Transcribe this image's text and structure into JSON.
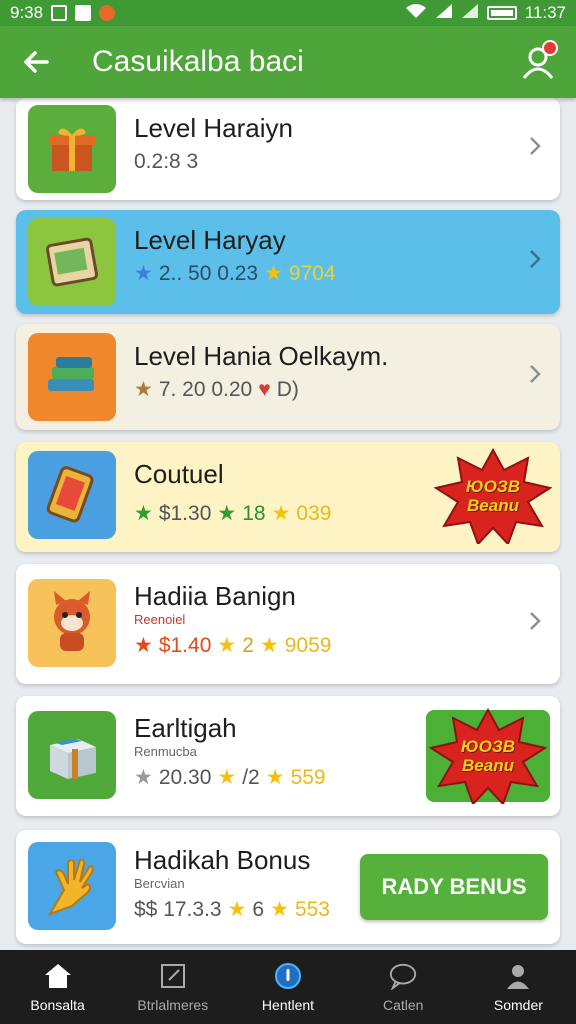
{
  "status_bar": {
    "time": "9:38",
    "clock": "11:37"
  },
  "app_bar": {
    "title": "Casuikalba baci"
  },
  "items": [
    {
      "name": "Level Haraiyn",
      "meta": [
        "0.2:8 3"
      ],
      "icon": "gift-box-icon"
    },
    {
      "name": "Level Haryay",
      "meta": [
        "2.. 50 0.23",
        "9704"
      ],
      "icon": "book-icon"
    },
    {
      "name": "Level Hania Oelkaym.",
      "meta": [
        "7. 20 0.20",
        "D)"
      ],
      "icon": "books-icon"
    },
    {
      "name": "Coutuel",
      "meta": [
        "$1.30",
        "18",
        "039"
      ],
      "icon": "phone-card-icon",
      "burst": [
        "ЮОЗВ",
        "Beanu"
      ]
    },
    {
      "name": "Hadiia Banign",
      "sub": "Reenoiel",
      "meta": [
        "$1.40",
        "2",
        "9059"
      ],
      "icon": "fox-mascot-icon"
    },
    {
      "name": "Earltigah",
      "sub": "Renmucba",
      "meta": [
        "20.30",
        "/2",
        "559"
      ],
      "icon": "crate-icon",
      "burst": [
        "ЮОЗВ",
        "Beanu"
      ]
    },
    {
      "name": "Hadikah Bonus",
      "sub": "Bercvian",
      "meta": [
        "$$ 17.3.3",
        "6",
        "553"
      ],
      "icon": "golden-hand-icon",
      "button": "RADY BENUS"
    }
  ],
  "nav": [
    {
      "label": "Bonsalta",
      "icon": "home-icon"
    },
    {
      "label": "Btrlalmeres",
      "icon": "edit-icon"
    },
    {
      "label": "Hentlent",
      "icon": "circle-icon"
    },
    {
      "label": "Catlen",
      "icon": "chat-icon"
    },
    {
      "label": "Somder",
      "icon": "person-icon"
    }
  ]
}
